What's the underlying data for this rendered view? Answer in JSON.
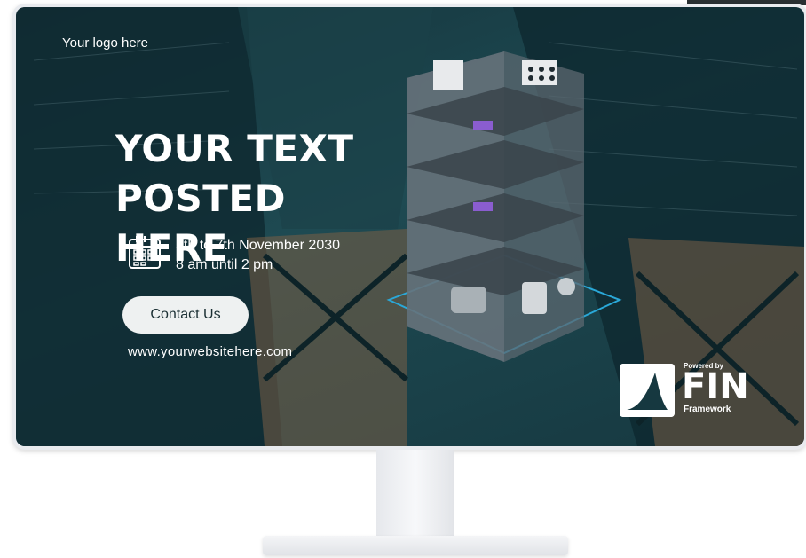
{
  "screen": {
    "logo_text": "Your logo here",
    "headline_line1": "YOUR TEXT",
    "headline_line2": "POSTED HERE",
    "event": {
      "date_range": "5th to 7th November 2030",
      "time_range": "8 am until 2 pm"
    },
    "contact_button_label": "Contact Us",
    "website": "www.yourwebsitehere.com"
  },
  "brand": {
    "powered_by": "Powered by",
    "name": "FIN",
    "subname": "Framework"
  },
  "colors": {
    "screen_bg": "#1e4a52",
    "accent_cyan": "#2aa8d8",
    "button_bg": "#eef1f1",
    "text": "#ffffff"
  },
  "icons": [
    "calendar-icon",
    "fin-logo-mark-icon"
  ]
}
